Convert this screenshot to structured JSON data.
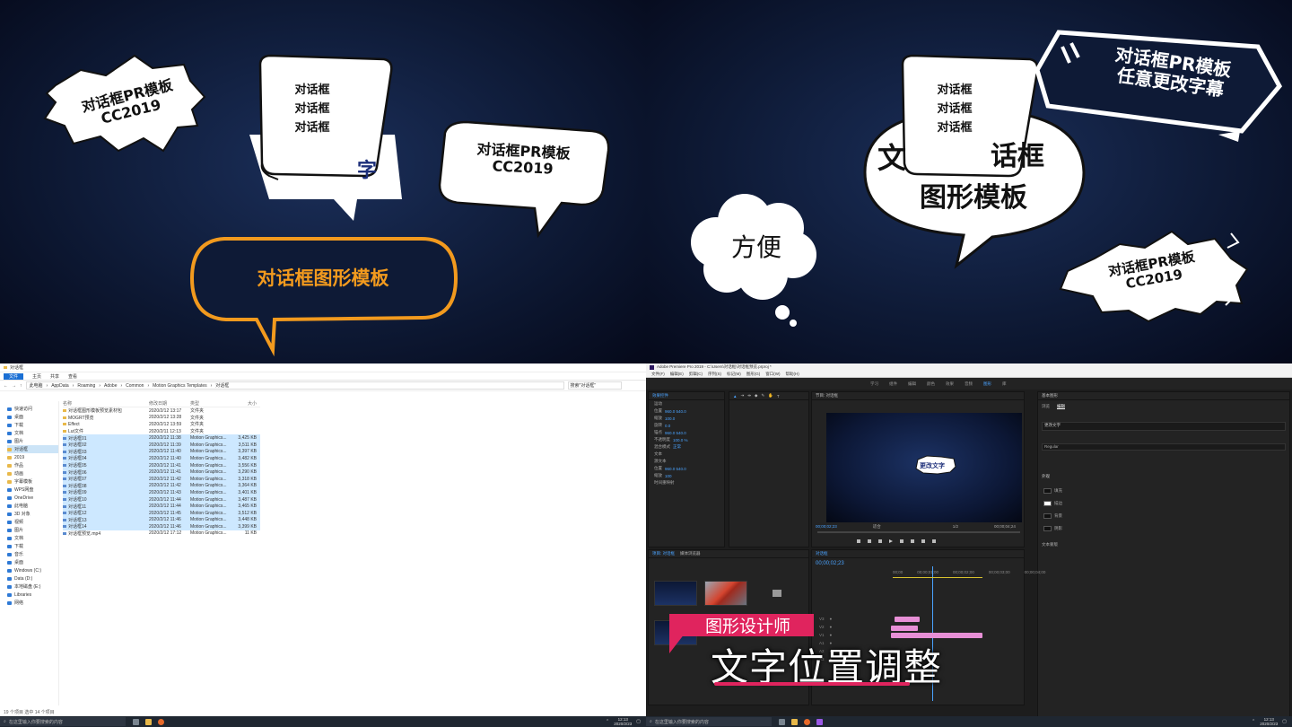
{
  "preview_left": {
    "burst_bubble": {
      "line1": "对话框PR模板",
      "line2": "CC2019"
    },
    "stacked_bubble": {
      "lines": [
        "对话框",
        "对话框",
        "对话框"
      ],
      "under_text": "字"
    },
    "oval_bubble": {
      "line1": "对话框PR模板",
      "line2": "CC2019"
    },
    "orange_bubble": {
      "text": "对话框图形模板"
    }
  },
  "preview_right": {
    "stacked_bubble": {
      "lines": [
        "对话框",
        "对话框",
        "对话框"
      ]
    },
    "big_bubble": {
      "line1_left": "文",
      "line1_right": "话框",
      "line2": "图形模板"
    },
    "banner": {
      "line1": "对话框PR模板",
      "line2": "任意更改字幕"
    },
    "cloud": {
      "text": "方便"
    },
    "burst_bubble": {
      "line1": "对话框PR模板",
      "line2": "CC2019"
    }
  },
  "explorer": {
    "title": "对话框",
    "ribbon": {
      "file": "文件",
      "home": "主页",
      "share": "共享",
      "view": "查看"
    },
    "breadcrumbs": [
      "此电脑",
      "AppData",
      "Roaming",
      "Adobe",
      "Common",
      "Motion Graphics Templates",
      "对话框"
    ],
    "search_placeholder": "搜索\"对话框\"",
    "columns": {
      "name": "名称",
      "date": "修改日期",
      "type": "类型",
      "size": "大小"
    },
    "nav": [
      {
        "label": "快速访问",
        "sel": false
      },
      {
        "label": "桌面",
        "sel": false
      },
      {
        "label": "下载",
        "sel": false
      },
      {
        "label": "文档",
        "sel": false
      },
      {
        "label": "图片",
        "sel": false
      },
      {
        "label": "对话框",
        "sel": true
      },
      {
        "label": "2019",
        "sel": false
      },
      {
        "label": "作品",
        "sel": false
      },
      {
        "label": "动画",
        "sel": false
      },
      {
        "label": "字幕模板",
        "sel": false
      },
      {
        "label": "WPS网盘",
        "sel": false
      },
      {
        "label": "OneDrive",
        "sel": false
      },
      {
        "label": "此电脑",
        "sel": false
      },
      {
        "label": "3D 对象",
        "sel": false
      },
      {
        "label": "视频",
        "sel": false
      },
      {
        "label": "图片",
        "sel": false
      },
      {
        "label": "文档",
        "sel": false
      },
      {
        "label": "下载",
        "sel": false
      },
      {
        "label": "音乐",
        "sel": false
      },
      {
        "label": "桌面",
        "sel": false
      },
      {
        "label": "Windows (C:)",
        "sel": false
      },
      {
        "label": "Data (D:)",
        "sel": false
      },
      {
        "label": "本地磁盘 (E:)",
        "sel": false
      },
      {
        "label": "Libraries",
        "sel": false
      },
      {
        "label": "网络",
        "sel": false
      }
    ],
    "rows": [
      {
        "name": "对话框图形模板预览素材包",
        "date": "2020/2/12 13:17",
        "type": "文件夹",
        "size": "",
        "folder": true,
        "sel": false
      },
      {
        "name": "MOGRT预览",
        "date": "2020/2/12 13:28",
        "type": "文件夹",
        "size": "",
        "folder": true,
        "sel": false
      },
      {
        "name": "Effect",
        "date": "2020/2/12 13:59",
        "type": "文件夹",
        "size": "",
        "folder": true,
        "sel": false
      },
      {
        "name": "Lut文件",
        "date": "2020/2/11 12:13",
        "type": "文件夹",
        "size": "",
        "folder": true,
        "sel": false
      },
      {
        "name": "对话框01",
        "date": "2020/2/12 11:38",
        "type": "Motion Graphics...",
        "size": "3,425 KB",
        "folder": false,
        "sel": true
      },
      {
        "name": "对话框02",
        "date": "2020/2/12 11:39",
        "type": "Motion Graphics...",
        "size": "3,511 KB",
        "folder": false,
        "sel": true
      },
      {
        "name": "对话框03",
        "date": "2020/2/12 11:40",
        "type": "Motion Graphics...",
        "size": "3,397 KB",
        "folder": false,
        "sel": true
      },
      {
        "name": "对话框04",
        "date": "2020/2/12 11:40",
        "type": "Motion Graphics...",
        "size": "3,482 KB",
        "folder": false,
        "sel": true
      },
      {
        "name": "对话框05",
        "date": "2020/2/12 11:41",
        "type": "Motion Graphics...",
        "size": "3,556 KB",
        "folder": false,
        "sel": true
      },
      {
        "name": "对话框06",
        "date": "2020/2/12 11:41",
        "type": "Motion Graphics...",
        "size": "3,290 KB",
        "folder": false,
        "sel": true
      },
      {
        "name": "对话框07",
        "date": "2020/2/12 11:42",
        "type": "Motion Graphics...",
        "size": "3,318 KB",
        "folder": false,
        "sel": true
      },
      {
        "name": "对话框08",
        "date": "2020/2/12 11:42",
        "type": "Motion Graphics...",
        "size": "3,364 KB",
        "folder": false,
        "sel": true
      },
      {
        "name": "对话框09",
        "date": "2020/2/12 11:43",
        "type": "Motion Graphics...",
        "size": "3,401 KB",
        "folder": false,
        "sel": true
      },
      {
        "name": "对话框10",
        "date": "2020/2/12 11:44",
        "type": "Motion Graphics...",
        "size": "3,487 KB",
        "folder": false,
        "sel": true
      },
      {
        "name": "对话框11",
        "date": "2020/2/12 11:44",
        "type": "Motion Graphics...",
        "size": "3,465 KB",
        "folder": false,
        "sel": true
      },
      {
        "name": "对话框12",
        "date": "2020/2/12 11:45",
        "type": "Motion Graphics...",
        "size": "3,512 KB",
        "folder": false,
        "sel": true
      },
      {
        "name": "对话框13",
        "date": "2020/2/12 11:46",
        "type": "Motion Graphics...",
        "size": "3,448 KB",
        "folder": false,
        "sel": true
      },
      {
        "name": "对话框14",
        "date": "2020/2/12 11:46",
        "type": "Motion Graphics...",
        "size": "3,399 KB",
        "folder": false,
        "sel": true
      },
      {
        "name": "对话框预览.mp4",
        "date": "2020/2/12 17:12",
        "type": "Motion Graphics...",
        "size": "11 KB",
        "folder": false,
        "sel": false
      }
    ],
    "status": "19 个项目    选中 14 个项目"
  },
  "taskbar_left": {
    "search": "在这里输入你要搜索的内容",
    "time": "12:13",
    "date": "2020/2/23"
  },
  "taskbar_right": {
    "search": "在这里输入你要搜索的内容",
    "time": "12:13",
    "date": "2020/2/23"
  },
  "premiere": {
    "title": "Adobe Premiere Pro 2019 - C:\\Users\\对话框\\对话框预览.prproj *",
    "menu": [
      "文件(F)",
      "编辑(E)",
      "剪辑(C)",
      "序列(S)",
      "标记(M)",
      "图形(G)",
      "窗口(W)",
      "帮助(H)"
    ],
    "workspaces": [
      "学习",
      "组件",
      "编辑",
      "颜色",
      "效果",
      "音频",
      "图形",
      "库"
    ],
    "effect_controls_tab": "效果控件",
    "source_tab": "源",
    "program_tab": "节目: 对话框",
    "program_timecode": "00;00;02;23",
    "fit": "适合",
    "zoom": "1/2",
    "duration": "00;00;04;24",
    "mini_bubble_text": "更改文字",
    "project_tab": "项目: 对话框",
    "media_browser_tab": "媒体浏览器",
    "timeline_tab": "对话框",
    "timeline_timecode": "00;00;02;23",
    "ruler": [
      "00;00",
      "00;00;01;00",
      "00;00;02;00",
      "00;00;03;00",
      "00;00;04;00"
    ],
    "tracks": [
      "V3",
      "V2",
      "V1",
      "A1",
      "A2",
      "A3"
    ],
    "essential_graphics": "基本图形",
    "eg_tabs": {
      "browse": "浏览",
      "edit": "编辑"
    },
    "eg_layer": "更改文字",
    "eg_font": "Regular",
    "eg_appearance": "外观",
    "eg_items": [
      "填充",
      "描边",
      "背景",
      "阴影"
    ],
    "eg_mask": "文本蒙版",
    "fx_rows": [
      {
        "label": "运动",
        "val": ""
      },
      {
        "label": "位置",
        "val": "960.0  540.0"
      },
      {
        "label": "缩放",
        "val": "100.0"
      },
      {
        "label": "旋转",
        "val": "0.0"
      },
      {
        "label": "锚点",
        "val": "960.0  540.0"
      },
      {
        "label": "不透明度",
        "val": "100.0 %"
      },
      {
        "label": "混合模式",
        "val": "正常"
      },
      {
        "label": "文本",
        "val": ""
      },
      {
        "label": "源文本",
        "val": ""
      },
      {
        "label": "位置",
        "val": "960.0  540.0"
      },
      {
        "label": "缩放",
        "val": "100"
      },
      {
        "label": "时间重映射",
        "val": ""
      }
    ]
  },
  "caption": {
    "tag": "图形设计师",
    "main": "文字位置调整"
  }
}
